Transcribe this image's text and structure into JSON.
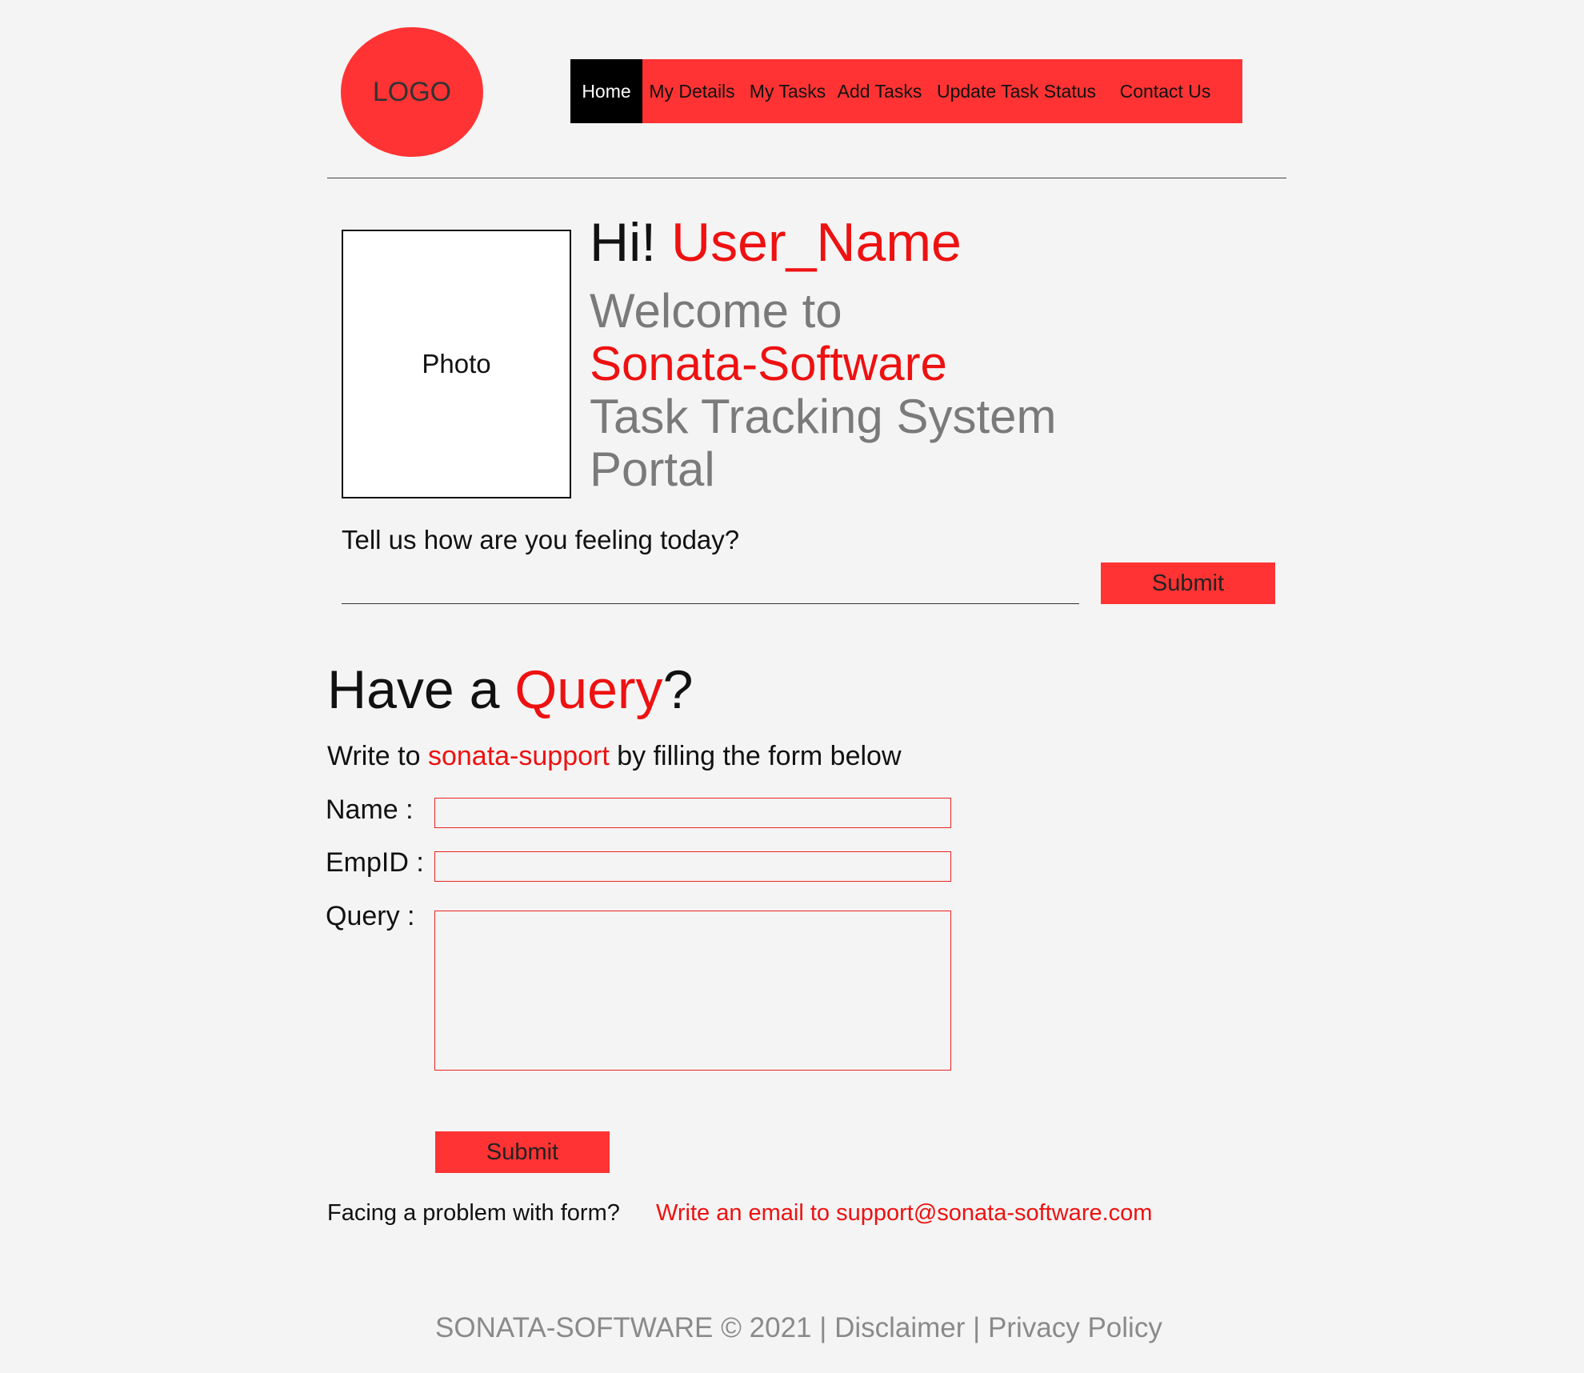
{
  "header": {
    "logo_text": "LOGO",
    "nav": [
      "Home",
      "My Details",
      "My Tasks",
      "Add Tasks",
      "Update Task Status",
      "Contact Us"
    ],
    "active_nav": "Home"
  },
  "hero": {
    "photo_label": "Photo",
    "greeting": "Hi!",
    "user_name": "User_Name",
    "welcome_line1": "Welcome to",
    "company": "Sonata-Software",
    "welcome_line3": "Task Tracking System",
    "welcome_line4": "Portal"
  },
  "feeling": {
    "label": "Tell us how are you feeling today?",
    "value": "",
    "submit_label": "Submit"
  },
  "query": {
    "title_prefix": "Have a",
    "title_highlight": "Query",
    "title_suffix": "?",
    "subtitle_prefix": "Write to",
    "subtitle_highlight": "sonata-support",
    "subtitle_suffix": "by filling the form below",
    "name_label": "Name :",
    "name_value": "",
    "empid_label": "EmpID :",
    "empid_value": "",
    "query_label": "Query :",
    "query_value": "",
    "submit_label": "Submit"
  },
  "help": {
    "problem_text": "Facing a problem with form?",
    "email_text": "Write an email to support@sonata-software.com"
  },
  "footer": {
    "copyright": "SONATA-SOFTWARE © 2021",
    "sep1": "|",
    "disclaimer": "Disclaimer",
    "sep2": "|",
    "privacy": "Privacy Policy"
  },
  "colors": {
    "accent": "#ff3333",
    "highlight_text": "#ee1111",
    "background": "#f4f4f4",
    "muted_text": "#7a7a7a"
  }
}
